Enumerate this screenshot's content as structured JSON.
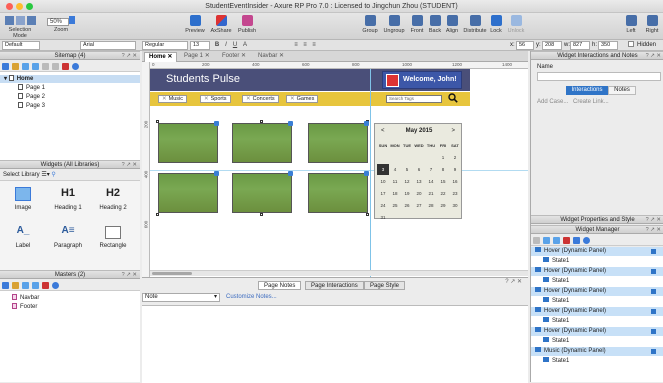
{
  "window": {
    "title": "StudentEventInsider - Axure RP Pro 7.0 : Licensed to Jingchun Zhou (STUDENT)"
  },
  "toolbar": {
    "selection_mode": "Selection Mode",
    "zoom_label": "Zoom",
    "zoom_value": "50%",
    "preview": "Preview",
    "axshare": "AxShare",
    "publish": "Publish",
    "group": "Group",
    "ungroup": "Ungroup",
    "front": "Front",
    "back": "Back",
    "align": "Align",
    "distribute": "Distribute",
    "lock": "Lock",
    "unlock": "Unlock",
    "left": "Left",
    "right": "Right"
  },
  "format": {
    "style": "Default",
    "font": "Arial",
    "weight": "Regular",
    "size": "13",
    "x_label": "x:",
    "x": "56",
    "y_label": "y:",
    "y": "208",
    "w_label": "w:",
    "w": "827",
    "h_label": "h:",
    "h": "350",
    "hidden": "Hidden"
  },
  "sitemap": {
    "title": "Sitemap (4)",
    "pages": [
      "Home",
      "Page 1",
      "Page 2",
      "Page 3"
    ]
  },
  "widgets": {
    "title": "Widgets (All Libraries)",
    "library": "Select Library",
    "items": [
      {
        "label": "Image",
        "glyph": ""
      },
      {
        "label": "Heading 1",
        "glyph": "H1"
      },
      {
        "label": "Heading 2",
        "glyph": "H2"
      },
      {
        "label": "Label",
        "glyph": "A_"
      },
      {
        "label": "Paragraph",
        "glyph": "A≡"
      },
      {
        "label": "Rectangle",
        "glyph": ""
      }
    ]
  },
  "masters": {
    "title": "Masters (2)",
    "items": [
      "Navbar",
      "Footer"
    ]
  },
  "tabs": [
    "Home",
    "Page 1",
    "Footer",
    "Navbar"
  ],
  "ruler": {
    "h": [
      "0",
      "200",
      "400",
      "600",
      "800",
      "1000",
      "1200",
      "1400"
    ],
    "v": [
      "200",
      "400",
      "600"
    ]
  },
  "design": {
    "title": "Students Pulse",
    "welcome": "Welcome, John!",
    "nav": [
      "Music",
      "Sports",
      "Concerts",
      "Games"
    ],
    "search_placeholder": "Search Tags",
    "calendar": {
      "month": "May 2015",
      "prev": "<",
      "next": ">",
      "days": [
        "SUN",
        "MON",
        "TUE",
        "WED",
        "THU",
        "FRI",
        "SAT"
      ],
      "weeks": [
        [
          "",
          "",
          "",
          "",
          "",
          "1",
          "2"
        ],
        [
          "3",
          "4",
          "5",
          "6",
          "7",
          "8",
          "9"
        ],
        [
          "10",
          "11",
          "12",
          "13",
          "14",
          "15",
          "16"
        ],
        [
          "17",
          "18",
          "19",
          "20",
          "21",
          "22",
          "23"
        ],
        [
          "24",
          "25",
          "26",
          "27",
          "28",
          "29",
          "30"
        ],
        [
          "31",
          "",
          "",
          "",
          "",
          "",
          ""
        ]
      ],
      "today": "3"
    }
  },
  "bottom": {
    "tabs": [
      "Page Notes",
      "Page Interactions",
      "Page Style"
    ],
    "note_select": "Note",
    "customize": "Customize Notes..."
  },
  "interactions": {
    "title": "Widget Interactions and Notes",
    "name_label": "Name",
    "tabs": [
      "Interactions",
      "Notes"
    ],
    "add_case": "Add Case...",
    "create_link": "Create Link..."
  },
  "properties": {
    "title": "Widget Properties and Style"
  },
  "manager": {
    "title": "Widget Manager",
    "rows": [
      {
        "label": "Hover (Dynamic Panel)",
        "kind": "panel"
      },
      {
        "label": "State1",
        "kind": "state"
      },
      {
        "label": "Hover (Dynamic Panel)",
        "kind": "panel"
      },
      {
        "label": "State1",
        "kind": "state"
      },
      {
        "label": "Hover (Dynamic Panel)",
        "kind": "panel"
      },
      {
        "label": "State1",
        "kind": "state"
      },
      {
        "label": "Hover (Dynamic Panel)",
        "kind": "panel"
      },
      {
        "label": "State1",
        "kind": "state"
      },
      {
        "label": "Hover (Dynamic Panel)",
        "kind": "panel"
      },
      {
        "label": "State1",
        "kind": "state"
      },
      {
        "label": "Music (Dynamic Panel)",
        "kind": "panel"
      },
      {
        "label": "State1",
        "kind": "state"
      }
    ]
  },
  "colors": {
    "accent": "#2f74c7",
    "header": "#4a4f79",
    "navbar": "#e7c53d"
  }
}
